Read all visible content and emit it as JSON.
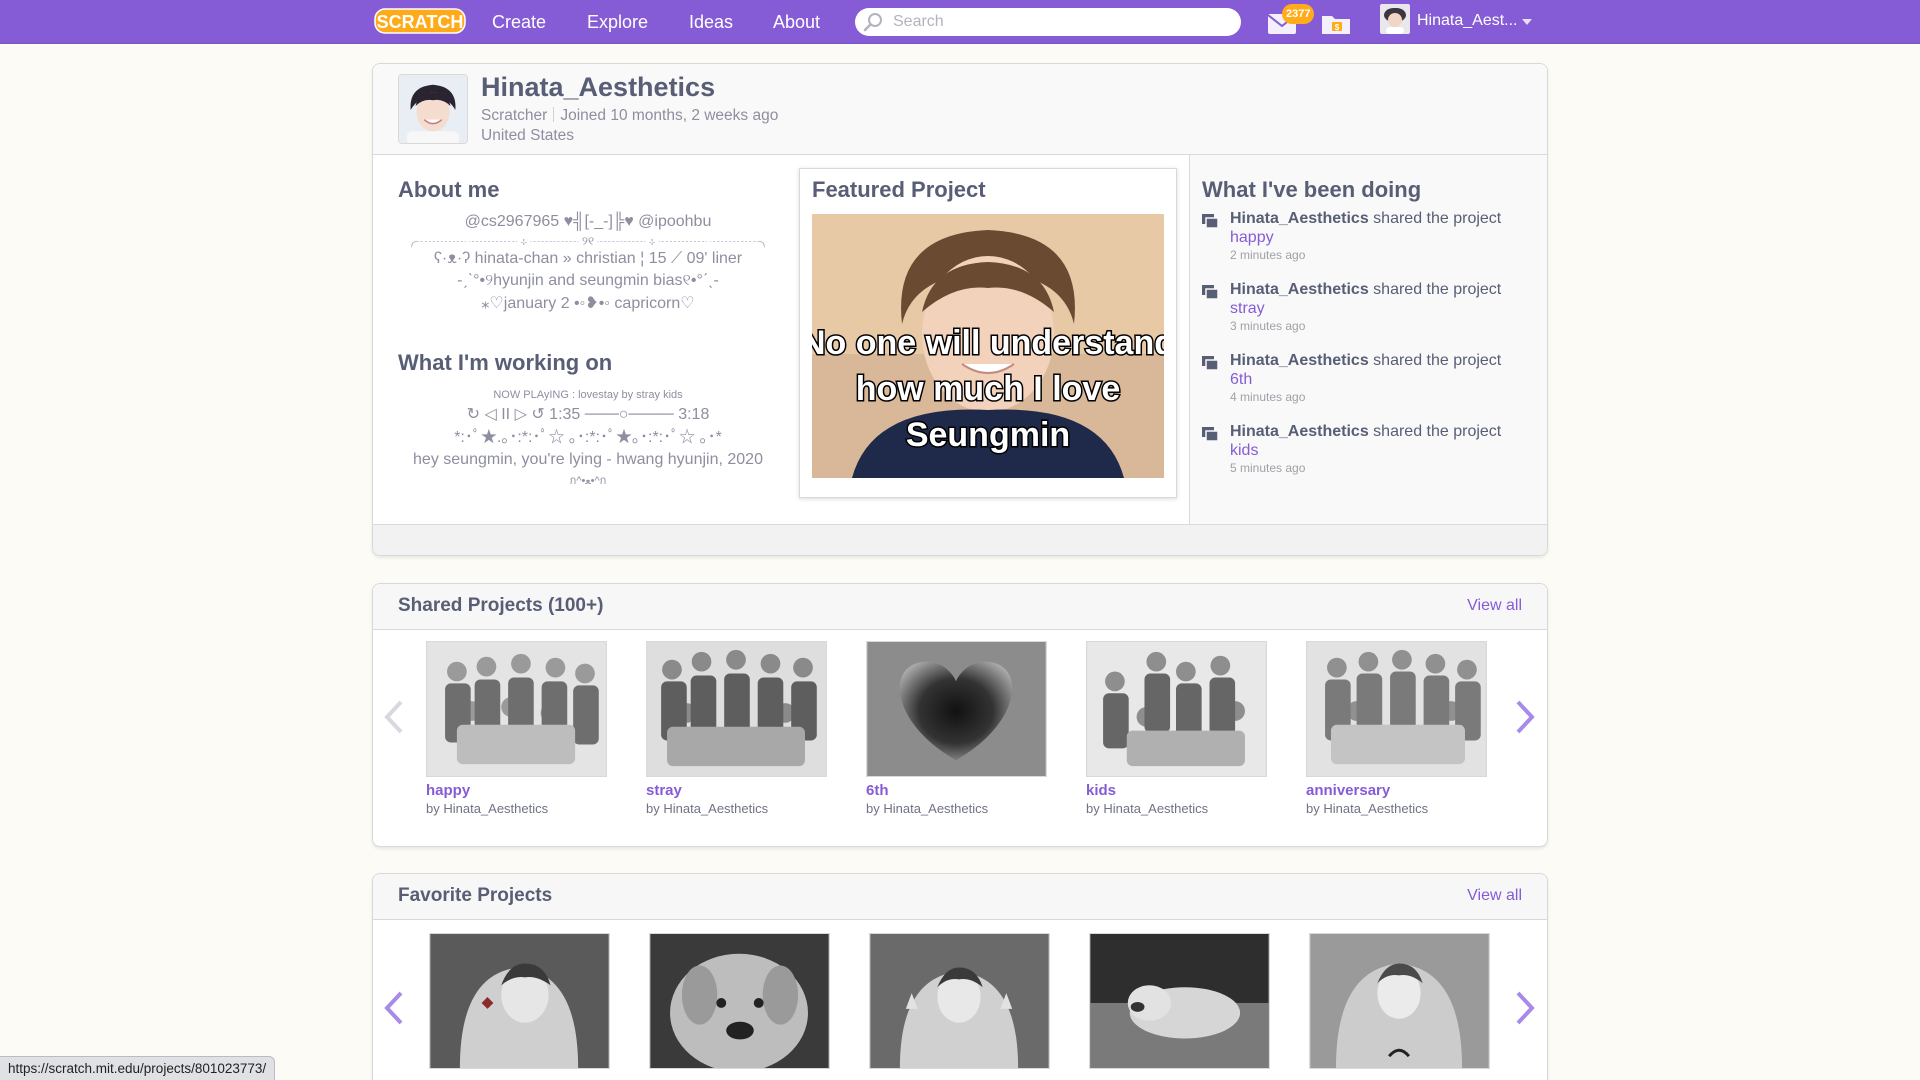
{
  "nav": {
    "logo_text": "SCRATCH",
    "create": "Create",
    "explore": "Explore",
    "ideas": "Ideas",
    "about": "About",
    "search_placeholder": "Search",
    "messages_count": "2377",
    "account_name": "Hinata_Aest...",
    "bar_color": "#855cd6"
  },
  "profile": {
    "username": "Hinata_Aesthetics",
    "role": "Scratcher",
    "joined": "Joined 10 months, 2 weeks ago",
    "location": "United States",
    "about_title": "About me",
    "about_lines": [
      "@cs2967965 ♥╣[-_-]╠♥ @ipoohbu",
      "╭┈┈┈┈ ┈┈┈┈ ⊹ ┈┈┈┈ ୨୧ ┈┈┈┈ ⊹ ┈┈┈┈ ┈┈┈┈╮",
      "ʕ·ᴥ·ʔ hinata-chan » christian ¦ 15 ⟋ 09' liner",
      "-ˏˋ°•୨hyunjin and seungmin bias୧•°ˊˎ-",
      "⁎♡january 2 •◦❥•◦ capricorn♡"
    ],
    "working_title": "What I'm working on",
    "working_small": "NOW PLAyING : lovestay by stray kids",
    "working_lines": [
      "↻ ◁ II ▷ ↺ 1:35 ───○──── 3:18",
      "*:･ﾟ★.｡･:*:･ﾟ☆ ｡･:*:･ﾟ★｡･:*:･ﾟ☆ ｡･*",
      "hey seungmin, you're lying - hwang hyunjin, 2020"
    ],
    "working_last": "ก^•ﻌ•^ก",
    "featured_title": "Featured Project",
    "featured_caption": [
      "No one will understand",
      "how much I love",
      "Seungmin"
    ]
  },
  "activity": {
    "title": "What I've been doing",
    "items": [
      {
        "user": "Hinata_Aesthetics",
        "verb": "shared the project",
        "project": "happy",
        "time": "2 minutes ago"
      },
      {
        "user": "Hinata_Aesthetics",
        "verb": "shared the project",
        "project": "stray",
        "time": "3 minutes ago"
      },
      {
        "user": "Hinata_Aesthetics",
        "verb": "shared the project",
        "project": "6th",
        "time": "4 minutes ago"
      },
      {
        "user": "Hinata_Aesthetics",
        "verb": "shared the project",
        "project": "kids",
        "time": "5 minutes ago"
      }
    ]
  },
  "shared": {
    "title": "Shared Projects (100+)",
    "view_all": "View all",
    "projects": [
      {
        "title": "happy",
        "owner": "by Hinata_Aesthetics"
      },
      {
        "title": "stray",
        "owner": "by Hinata_Aesthetics"
      },
      {
        "title": "6th",
        "owner": "by Hinata_Aesthetics"
      },
      {
        "title": "kids",
        "owner": "by Hinata_Aesthetics"
      },
      {
        "title": "anniversary",
        "owner": "by Hinata_Aesthetics"
      }
    ]
  },
  "favorites": {
    "title": "Favorite Projects",
    "view_all": "View all"
  },
  "status_url": "https://scratch.mit.edu/projects/801023773/"
}
